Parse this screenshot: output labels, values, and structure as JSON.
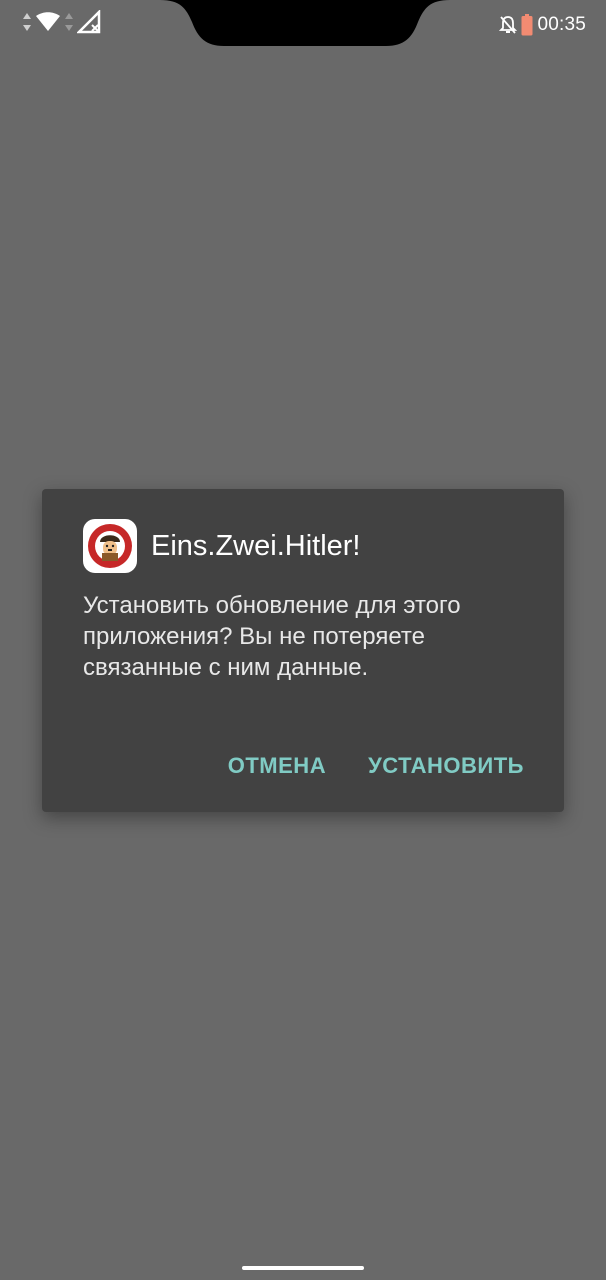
{
  "status_bar": {
    "time": "00:35",
    "icons": [
      "data-arrows-icon",
      "wifi-icon",
      "data-arrows-icon",
      "signal-no-sim-icon",
      "notifications-off-icon",
      "battery-low-icon"
    ],
    "colors": {
      "battery_low": "#f28b72"
    }
  },
  "dialog": {
    "app_name": "Eins.Zwei.Hitler!",
    "app_icon": "app-logo-icon",
    "message": "Установить обновление для этого приложения? Вы не потеряете связанные с ним данные.",
    "buttons": {
      "cancel": "ОТМЕНА",
      "install": "УСТАНОВИТЬ"
    },
    "colors": {
      "background": "#424242",
      "accent": "#80cbc4"
    }
  },
  "screen": {
    "background_color": "#696969"
  }
}
